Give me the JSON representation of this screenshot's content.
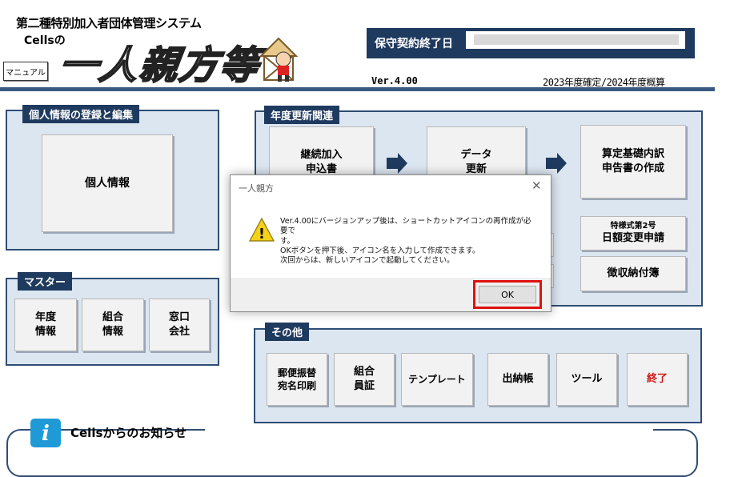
{
  "header": {
    "system_title": "第二種特別加入者団体管理システム",
    "cells_no": "Cellsの",
    "app_name": "一人親方等",
    "manual_button": "マニュアル",
    "maintenance_label": "保守契約終了日",
    "maintenance_value": "",
    "version": "Ver.4.00",
    "fiscal_years": "2023年度確定/2024年度概算"
  },
  "panels": {
    "personal": {
      "title": "個人情報の登録と編集",
      "button": "個人情報"
    },
    "master": {
      "title": "マスター",
      "buttons": [
        {
          "line1": "年度",
          "line2": "情報"
        },
        {
          "line1": "組合",
          "line2": "情報"
        },
        {
          "line1": "窓口",
          "line2": "会社"
        }
      ]
    },
    "annual": {
      "title": "年度更新関連",
      "renewal": {
        "line1": "継続加入",
        "line2": "申込書"
      },
      "data_update": {
        "line1": "データ",
        "line2": "更新"
      },
      "calc_report": {
        "line1": "算定基礎内訳",
        "line2": "申告書の作成"
      },
      "form_change": {
        "note": "特様式第2号",
        "label": "日額変更申請"
      },
      "collection": "徴収納付簿"
    },
    "other": {
      "title": "その他",
      "buttons": [
        {
          "line1": "郵便振替",
          "line2": "宛名印刷"
        },
        {
          "line1": "組合",
          "line2": "員証"
        },
        {
          "line1": "テンプレート",
          "line2": ""
        },
        {
          "line1": "出納帳",
          "line2": ""
        },
        {
          "line1": "ツール",
          "line2": ""
        },
        {
          "line1": "終了",
          "line2": ""
        }
      ]
    }
  },
  "news": {
    "icon": "info-icon",
    "icon_glyph": "i",
    "title": "Cellsからのお知らせ"
  },
  "dialog": {
    "title": "一人親方",
    "close_glyph": "✕",
    "warning_glyph": "!",
    "message_lines": [
      "Ver.4.00にバージョンアップ後は、ショートカットアイコンの再作成が必要で",
      "す。",
      "OKボタンを押下後、アイコン名を入力して作成できます。",
      "次回からは、新しいアイコンで起動してください。"
    ],
    "ok_button": "OK"
  },
  "colors": {
    "navy": "#1f3a5f",
    "panel_bg": "#dce6f1",
    "exit_red": "#d01a1a",
    "highlight_red": "#e01010"
  }
}
